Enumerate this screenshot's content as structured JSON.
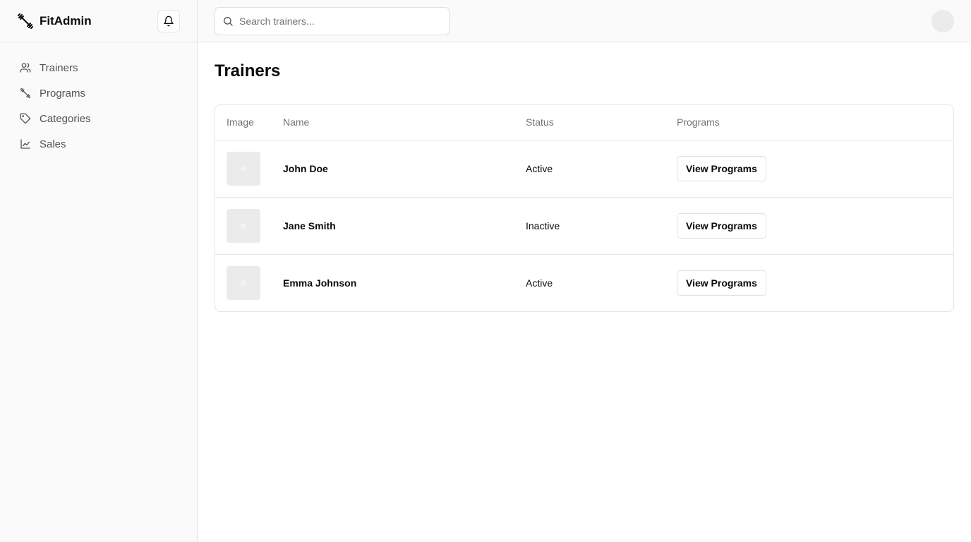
{
  "app": {
    "name": "FitAdmin"
  },
  "sidebar": {
    "items": [
      {
        "label": "Trainers",
        "icon": "users-icon"
      },
      {
        "label": "Programs",
        "icon": "dumbbell-icon"
      },
      {
        "label": "Categories",
        "icon": "tag-icon"
      },
      {
        "label": "Sales",
        "icon": "line-chart-icon"
      }
    ]
  },
  "search": {
    "placeholder": "Search trainers...",
    "value": ""
  },
  "main": {
    "title": "Trainers",
    "table": {
      "headers": {
        "image": "Image",
        "name": "Name",
        "status": "Status",
        "programs": "Programs"
      },
      "rows": [
        {
          "name": "John Doe",
          "status": "Active",
          "action": "View Programs"
        },
        {
          "name": "Jane Smith",
          "status": "Inactive",
          "action": "View Programs"
        },
        {
          "name": "Emma Johnson",
          "status": "Active",
          "action": "View Programs"
        }
      ]
    }
  },
  "colors": {
    "sidebar_bg": "#fafafa",
    "border": "#e5e5e5",
    "muted_text": "#71717a",
    "text": "#0a0a0a"
  }
}
